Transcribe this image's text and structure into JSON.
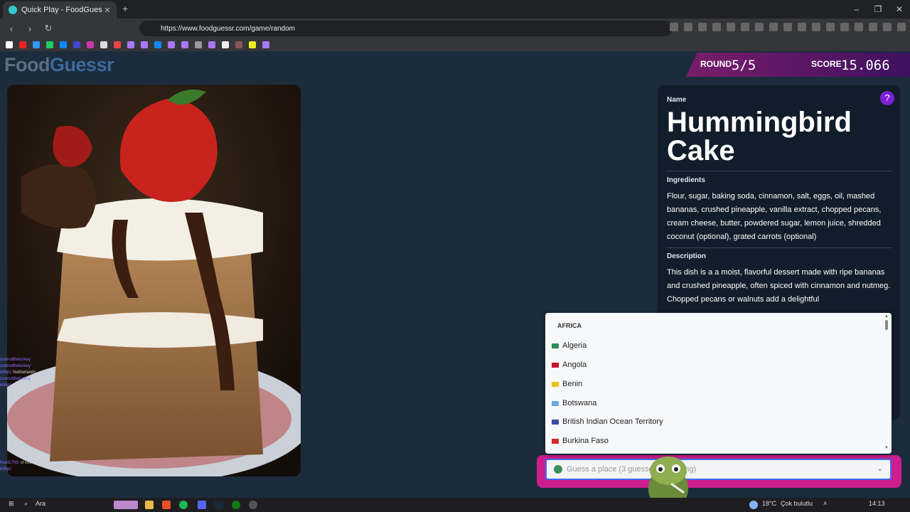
{
  "browser": {
    "tab_title": "Quick Play - FoodGuessr | Food...",
    "url": "https://www.foodguessr.com/game/random"
  },
  "logo": {
    "part1": "Food",
    "part2": "Guessr"
  },
  "banner": {
    "round_label": "ROUND",
    "round_value": "5/5",
    "score_label": "SCORE",
    "score_value": "15.066"
  },
  "card": {
    "name_label": "Name",
    "dish_name": "Hummingbird Cake",
    "ingredients_label": "Ingredients",
    "ingredients": "Flour, sugar, baking soda, cinnamon, salt, eggs, oil, mashed bananas, crushed pineapple, vanilla extract, chopped pecans, cream cheese, butter, powdered sugar, lemon juice, shredded coconut (optional), grated carrots (optional)",
    "description_label": "Description",
    "description": "This dish is a a moist, flavorful dessert made with ripe bananas and crushed pineapple, often spiced with cinnamon and nutmeg. Chopped pecans or walnuts add a delightful"
  },
  "dropdown": {
    "region": "AFRICA",
    "countries": [
      {
        "name": "Algeria",
        "flag": "#2e8b57"
      },
      {
        "name": "Angola",
        "flag": "#c8102e"
      },
      {
        "name": "Benin",
        "flag": "#e8c21a"
      },
      {
        "name": "Botswana",
        "flag": "#6fa8dc"
      },
      {
        "name": "British Indian Ocean Territory",
        "flag": "#3a4da0"
      },
      {
        "name": "Burkina Faso",
        "flag": "#d62828"
      }
    ]
  },
  "guess": {
    "placeholder": "Guess a place (3 guesses remaining)"
  },
  "chat": [
    {
      "user": "zumruttheturkey",
      "msg": ""
    },
    {
      "user": "zumruttheturkey",
      "msg": ""
    },
    {
      "user": "kiWpi",
      "msg": "Netherlands"
    },
    {
      "user": "zumruttheturkey",
      "msg": ""
    },
    {
      "user": "kiWpi",
      "msg": "zum"
    },
    {
      "user": "Kiari1709",
      "msg": "st louis"
    },
    {
      "user": "kiWpi",
      "msg": ""
    }
  ],
  "taskbar": {
    "search": "Ara",
    "weather": "18°C",
    "weather_desc": "Çok bulutlu",
    "time": "14:13"
  }
}
